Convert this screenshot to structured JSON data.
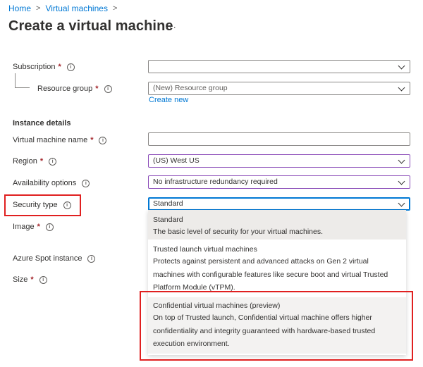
{
  "breadcrumb": [
    {
      "label": "Home"
    },
    {
      "label": "Virtual machines"
    }
  ],
  "page": {
    "title": "Create a virtual machine",
    "more": "···"
  },
  "form": {
    "subscription": {
      "label": "Subscription",
      "required": "*",
      "value": ""
    },
    "resource_group": {
      "label": "Resource group",
      "required": "*",
      "placeholder": "(New) Resource group",
      "create_new": "Create new"
    },
    "instance_details": "Instance details",
    "vm_name": {
      "label": "Virtual machine name",
      "required": "*",
      "value": ""
    },
    "region": {
      "label": "Region",
      "required": "*",
      "value": "(US) West US"
    },
    "availability": {
      "label": "Availability options",
      "value": "No infrastructure redundancy required"
    },
    "security_type": {
      "label": "Security type",
      "value": "Standard"
    },
    "image": {
      "label": "Image",
      "required": "*"
    },
    "spot": {
      "label": "Azure Spot instance"
    },
    "size": {
      "label": "Size",
      "required": "*"
    }
  },
  "security_options": [
    {
      "title": "Standard",
      "desc": "The basic level of security for your virtual machines."
    },
    {
      "title": "Trusted launch virtual machines",
      "desc": "Protects against persistent and advanced attacks on Gen 2 virtual machines with configurable features like secure boot and virtual Trusted Platform Module (vTPM)."
    },
    {
      "title": "Confidential virtual machines (preview)",
      "desc": "On top of Trusted launch, Confidential virtual machine offers higher confidentiality and integrity guaranteed with hardware-based trusted execution environment."
    }
  ],
  "colors": {
    "link": "#0078d4",
    "required": "#a4262c",
    "highlight": "#e02020",
    "focus": "#0078d4"
  },
  "icons": {
    "info": "info-icon",
    "chevron": "chevron-down-icon",
    "breadcrumb_sep": "chevron-right-icon"
  }
}
